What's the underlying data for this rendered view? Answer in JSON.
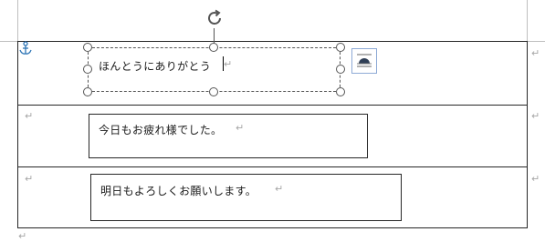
{
  "document": {
    "paragraph_mark": "↵",
    "rows": [
      {
        "text": "ほんとうにありがとう"
      },
      {
        "text": "今日もお疲れ様でした。"
      },
      {
        "text": "明日もよろしくお願いします。"
      }
    ]
  },
  "icons": {
    "rotate": "rotate-handle-icon",
    "anchor": "anchor-icon",
    "layout_options": "layout-options-icon"
  },
  "colors": {
    "border": "#262626",
    "anchor": "#2e75b6",
    "layout_button_border": "#8eaad6",
    "formatting_marks": "#a6a6a6"
  }
}
